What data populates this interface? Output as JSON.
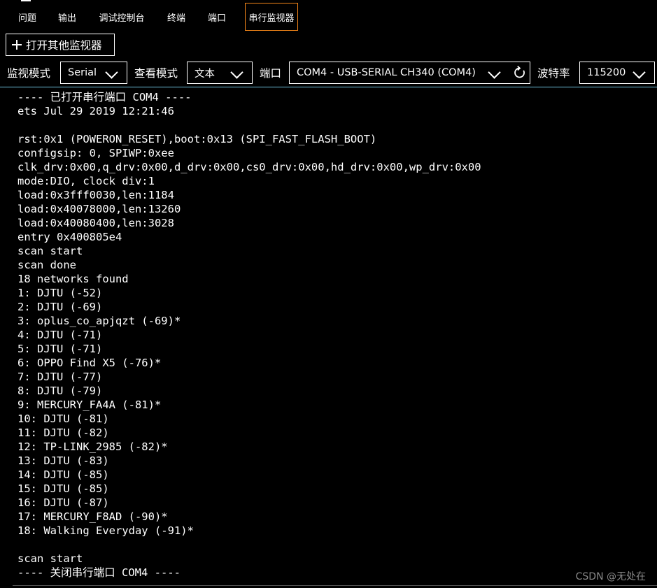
{
  "tabs": [
    {
      "label": "问题",
      "active": false
    },
    {
      "label": "输出",
      "active": false
    },
    {
      "label": "调试控制台",
      "active": false
    },
    {
      "label": "终端",
      "active": false
    },
    {
      "label": "端口",
      "active": false
    },
    {
      "label": "串行监视器",
      "active": true
    }
  ],
  "toolbar": {
    "open_monitor_label": "打开其他监视器",
    "monitor_mode_label": "监视模式",
    "monitor_mode_value": "Serial",
    "view_mode_label": "查看模式",
    "view_mode_value": "文本",
    "port_label": "端口",
    "port_value": "COM4 - USB-SERIAL CH340 (COM4)",
    "baud_label": "波特率",
    "baud_value": "115200"
  },
  "output_lines": [
    "---- 已打开串行端口 COM4 ----",
    "ets Jul 29 2019 12:21:46",
    "",
    "rst:0x1 (POWERON_RESET),boot:0x13 (SPI_FAST_FLASH_BOOT)",
    "configsip: 0, SPIWP:0xee",
    "clk_drv:0x00,q_drv:0x00,d_drv:0x00,cs0_drv:0x00,hd_drv:0x00,wp_drv:0x00",
    "mode:DIO, clock div:1",
    "load:0x3fff0030,len:1184",
    "load:0x40078000,len:13260",
    "load:0x40080400,len:3028",
    "entry 0x400805e4",
    "scan start",
    "scan done",
    "18 networks found",
    "1: DJTU (-52)",
    "2: DJTU (-69)",
    "3: oplus_co_apjqzt (-69)*",
    "4: DJTU (-71)",
    "5: DJTU (-71)",
    "6: OPPO Find X5 (-76)*",
    "7: DJTU (-77)",
    "8: DJTU (-79)",
    "9: MERCURY_FA4A (-81)*",
    "10: DJTU (-81)",
    "11: DJTU (-82)",
    "12: TP-LINK_2985 (-82)*",
    "13: DJTU (-83)",
    "14: DJTU (-85)",
    "15: DJTU (-85)",
    "16: DJTU (-87)",
    "17: MERCURY_F8AD (-90)*",
    "18: Walking Everyday (-91)*",
    "",
    "scan start",
    "---- 关闭串行端口 COM4 ----"
  ],
  "watermark": "CSDN @无处在",
  "colors": {
    "background": "#000000",
    "text": "#ffffff",
    "active_tab_border": "#f38518",
    "separator": "#6fc3df"
  }
}
